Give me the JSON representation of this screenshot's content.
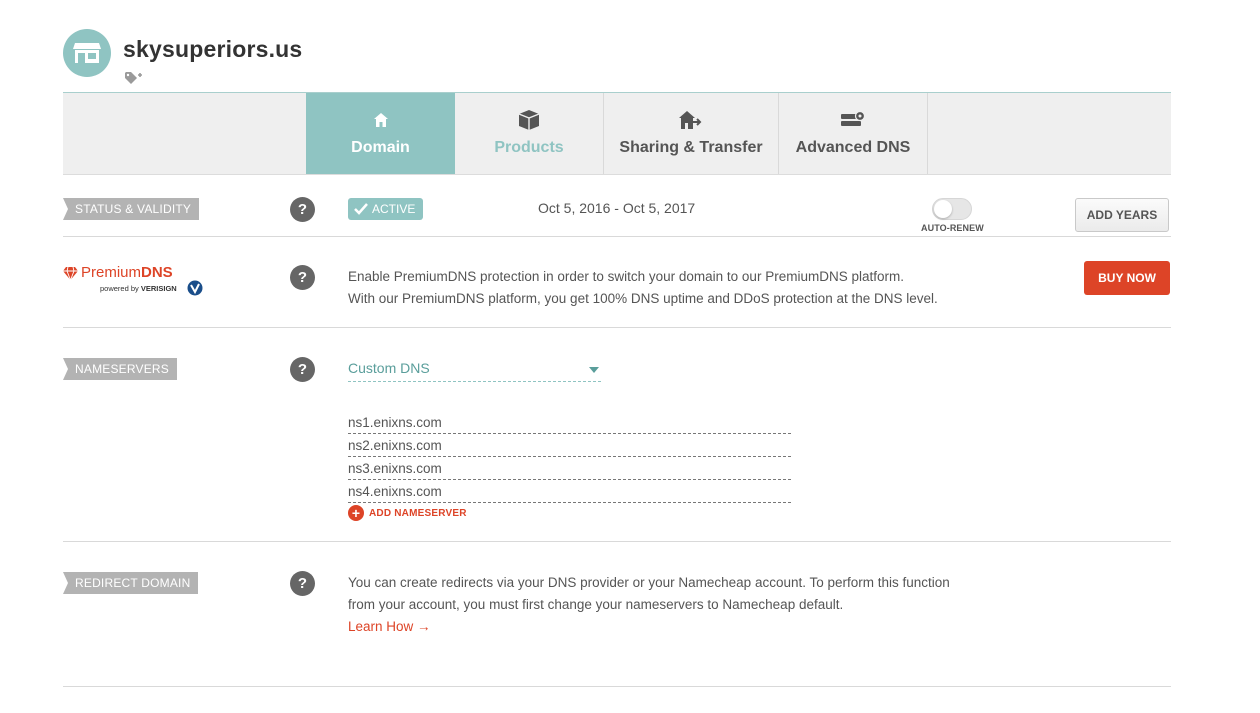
{
  "domain": {
    "name": "skysuperiors.us"
  },
  "tabs": [
    {
      "label": "Domain",
      "icon": "home-icon",
      "active": true
    },
    {
      "label": "Products",
      "icon": "box-icon",
      "active": false
    },
    {
      "label": "Sharing & Transfer",
      "icon": "house-transfer-icon",
      "active": false
    },
    {
      "label": "Advanced DNS",
      "icon": "server-gear-icon",
      "active": false
    }
  ],
  "status": {
    "label": "STATUS & VALIDITY",
    "badge": "ACTIVE",
    "dates": "Oct 5, 2016 - Oct 5, 2017",
    "auto_renew_label": "AUTO-RENEW",
    "auto_renew_on": false,
    "add_years_label": "ADD YEARS"
  },
  "premium_dns": {
    "brand_prefix": "Premium",
    "brand_suffix": "DNS",
    "powered_by": "powered by",
    "partner": "VERISIGN",
    "line1": "Enable PremiumDNS protection in order to switch your domain to our PremiumDNS platform.",
    "line2": "With our PremiumDNS platform, you get 100% DNS uptime and DDoS protection at the DNS level.",
    "buy_label": "BUY NOW"
  },
  "nameservers": {
    "label": "NAMESERVERS",
    "selected": "Custom DNS",
    "entries": [
      " ns1.enixns.com",
      "ns2.enixns.com",
      "ns3.enixns.com",
      "ns4.enixns.com"
    ],
    "add_label": "ADD NAMESERVER"
  },
  "redirect": {
    "label": "REDIRECT DOMAIN",
    "text": "You can create redirects via your DNS provider or your Namecheap account. To perform this function from your account, you must first change your nameservers to Namecheap default.",
    "link": "Learn How →"
  },
  "help_glyph": "?",
  "colors": {
    "accent": "#8fc4c2",
    "danger": "#dd4427",
    "label_gray": "#b3b3b3"
  }
}
